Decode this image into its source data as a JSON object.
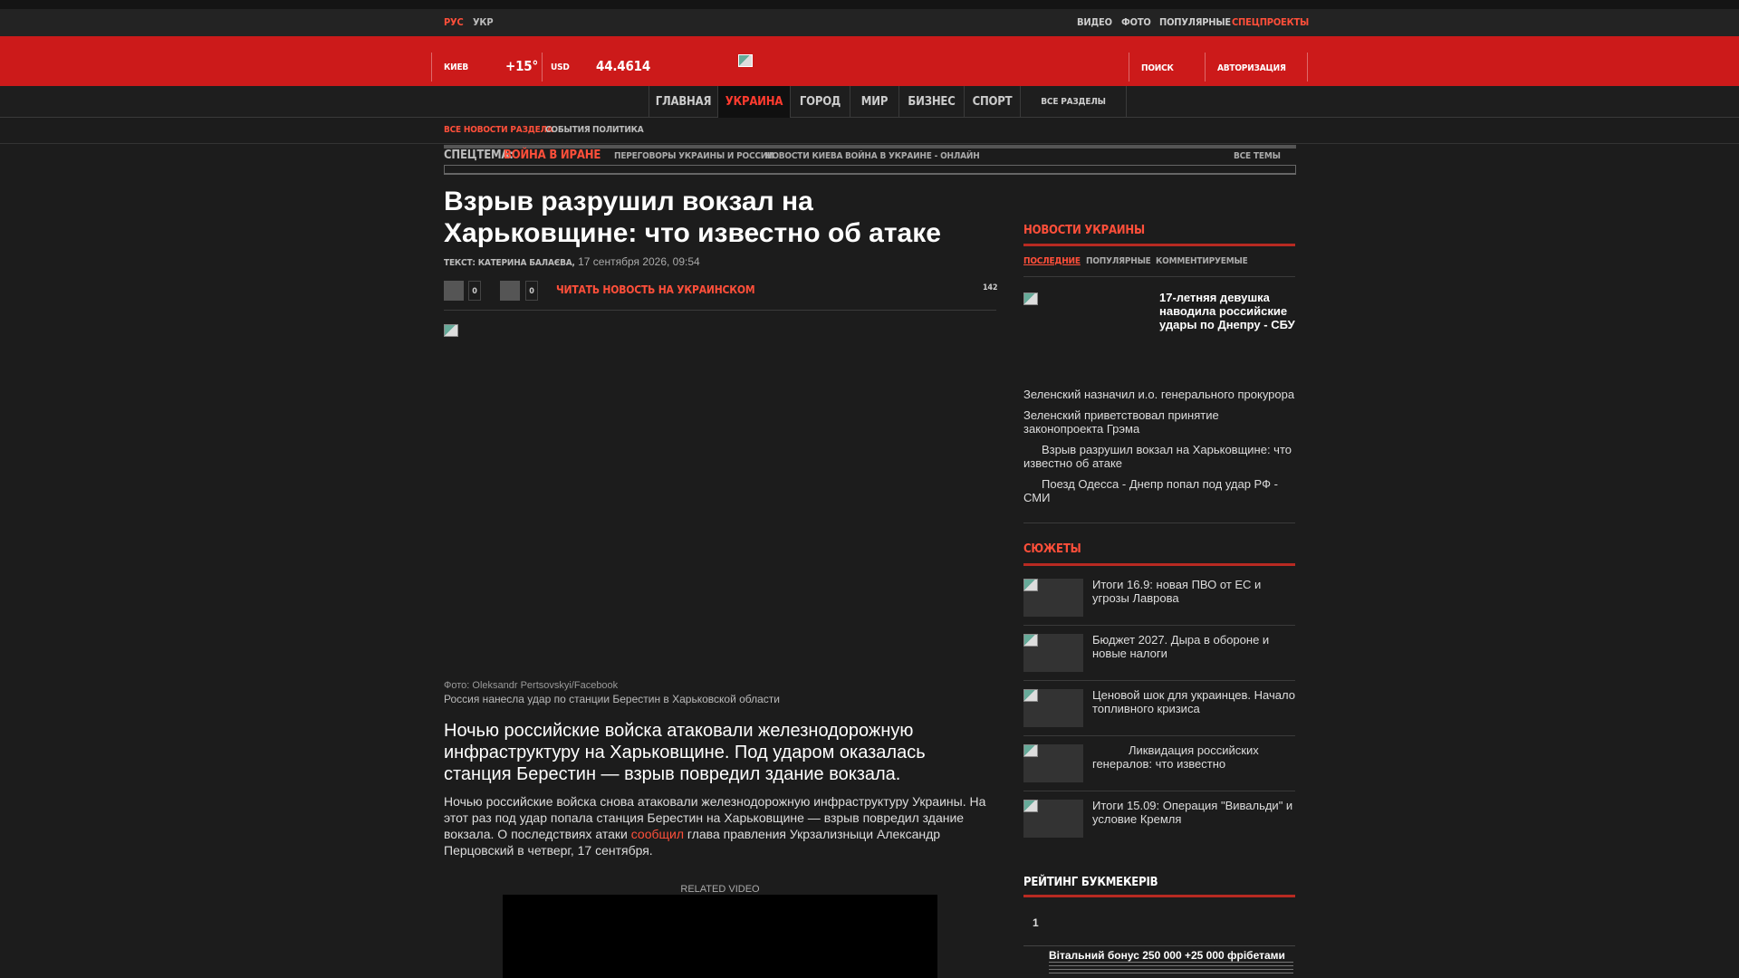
{
  "lang": {
    "ru": "РУС",
    "uk": "УКР"
  },
  "toplinks": {
    "video": "ВИДЕО",
    "photo": "ФОТО",
    "popular": "ПОПУЛЯРНЫЕ",
    "special": "СПЕЦПРОЕКТЫ"
  },
  "header": {
    "city": "КИЕВ",
    "temp": "+15°",
    "currency": "USD",
    "rate": "44.4614",
    "search": "ПОИСК",
    "login": "АВТОРИЗАЦИЯ"
  },
  "nav": [
    "ГЛАВНАЯ",
    "УКРАИНА",
    "ГОРОД",
    "МИР",
    "БИЗНЕС",
    "СПОРТ"
  ],
  "nav_all": "ВСЕ РАЗДЕЛЫ",
  "subnav": {
    "all": "ВСЕ НОВОСТИ РАЗДЕЛА",
    "events": "СОБЫТИЯ",
    "politics": "ПОЛИТИКА"
  },
  "spec": {
    "label": "СПЕЦТЕМА:",
    "main": "ВОЙНА В ИРАНЕ",
    "link1": "ПЕРЕГОВОРЫ УКРАИНЫ И РОССИИ",
    "link2": "НОВОСТИ КИЕВА",
    "link3": "ВОЙНА В УКРАИНЕ - ОНЛАЙН",
    "all": "ВСЕ ТЕМЫ"
  },
  "article": {
    "title": "Взрыв разрушил вокзал на Харьковщине: что известно об атаке",
    "author": "ТЕКСТ: КАТЕРИНА БАЛАЄВА,",
    "date": "17 сентября 2026, 09:54",
    "share1": "0",
    "share2": "0",
    "read_ukr": "ЧИТАТЬ НОВОСТЬ НА УКРАИНСКОМ",
    "views": "142",
    "photo_credit": "Фото: Oleksandr Pertsovskyi/Facebook",
    "photo_caption": "Россия нанесла удар по станции Берестин в Харьковской области",
    "lead": "Ночью российские войска атаковали железнодорожную инфраструктуру на Харьковщине. Под ударом оказалась станция Берестин — взрыв повредил здание вокзала.",
    "body_before": "Ночью российские войска снова атаковали железнодорожную инфраструктуру Украины. На этот раз под удар попала станция Берестин на Харьковщине — взрыв повредил здание вокзала. О последствиях атаки ",
    "body_link": "сообщил",
    "body_after": " глава правления Укрзализныци Александр Перцовский в четверг, 17 сентября.",
    "related_video": "RELATED VIDEO"
  },
  "sidebar": {
    "news_head": "НОВОСТИ УКРАИНЫ",
    "tabs": [
      "ПОСЛЕДНИЕ",
      "ПОПУЛЯРНЫЕ",
      "КОММЕНТИРУЕМЫЕ"
    ],
    "featured": "17-летняя девушка наводила российские удары по Днепру - СБУ",
    "news": [
      "Зеленский назначил и.о. генерального прокурора",
      "Зеленский приветствовал принятие законопроекта Грэма",
      "Взрыв разрушил вокзал на Харьковщине: что известно об атаке",
      "Поезд Одесса - Днепр попал под удар РФ - СМИ"
    ],
    "stories_head": "СЮЖЕТЫ",
    "stories": [
      "Итоги 16.9: новая ПВО от ЕС и угрозы Лаврова",
      "Бюджет 2027. Дыра в обороне и новые налоги",
      "Ценовой шок для украинцев. Начало топливного кризиса",
      "Ликвидация российских генералов: что известно",
      "Итоги 15.09: Операция \"Вивальди\" и условие Кремля"
    ],
    "bookmakers_head": "РЕЙТИНГ БУКМЕКЕРІВ",
    "bk_rank": "1",
    "bk_bonus": "Вітальний бонус 250 000 +25 000 фрібетами"
  },
  "colors": {
    "brand_red": "#cc1a1a",
    "accent": "#ff4f3a",
    "bg": "#1c1c1c"
  }
}
